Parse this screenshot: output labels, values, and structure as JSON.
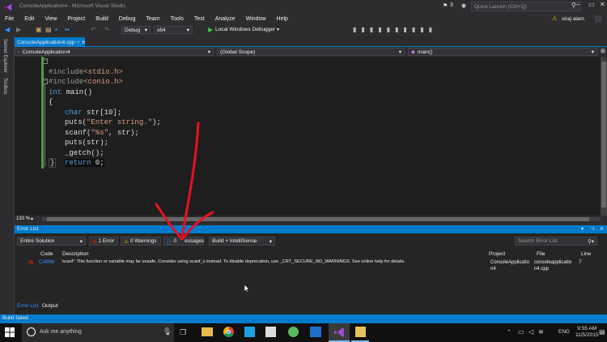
{
  "window": {
    "title": "ConsoleApplication4 - Microsoft Visual Studio",
    "notifications": "3",
    "quick_launch_placeholder": "Quick Launch (Ctrl+Q)",
    "user": "siraj alam"
  },
  "menu": [
    "File",
    "Edit",
    "View",
    "Project",
    "Build",
    "Debug",
    "Team",
    "Tools",
    "Test",
    "Analyze",
    "Window",
    "Help"
  ],
  "toolbar": {
    "config": "Debug",
    "platform": "x64",
    "run_label": "Local Windows Debugger"
  },
  "tab": {
    "label": "ConsoleApplication4.cpp"
  },
  "sidebar": {
    "server_explorer": "Server Explorer",
    "toolbox": "Toolbox"
  },
  "nav": {
    "project": "ConsoleApplication4",
    "scope": "(Global Scope)",
    "member": "main()"
  },
  "code": {
    "line1a": "#include",
    "line1b": "<stdio.h>",
    "line2a": "#include",
    "line2b": "<conio.h>",
    "line3a": "int",
    "line3b": " main()",
    "line4": "{",
    "line5a": "char",
    "line5b": " str[10];",
    "line6a": "puts(",
    "line6b": "\"Enter string.\"",
    "line6c": ");",
    "line7a": "scanf(",
    "line7b": "\"%s\"",
    "line7c": ", str);",
    "line8": "puts(str);",
    "line9": "_getch();",
    "line10a": "return",
    "line10b": " 0;",
    "line11": "}"
  },
  "zoom": "133 %",
  "error_list": {
    "title": "Error List",
    "scope": "Entire Solution",
    "errors": "1 Error",
    "warnings": "0 Warnings",
    "messages_prefix": "0",
    "messages_suffix": "essages",
    "build_filter": "Build + IntelliSense",
    "search_placeholder": "Search Error List",
    "columns": {
      "code": "Code",
      "description": "Description",
      "project": "Project",
      "file": "File",
      "line": "Line"
    },
    "rows": [
      {
        "code": "C4996",
        "description": "'scanf': This function or variable may be unsafe. Consider using scanf_s instead. To disable deprecation, use _CRT_SECURE_NO_WARNINGS. See online help for details.",
        "project_1": "ConsoleApplicatio",
        "project_2": "n4",
        "file_1": "consoleapplicatio",
        "file_2": "n4.cpp",
        "line": "7"
      }
    ],
    "bottom_tabs": [
      "Error List",
      "Output"
    ]
  },
  "status": {
    "text": "Build failed"
  },
  "taskbar": {
    "search_placeholder": "Ask me anything",
    "lang": "ENG",
    "time": "9:55 AM",
    "date": "11/5/2015"
  },
  "colors": {
    "accent": "#007acc",
    "error": "#e51400",
    "annotation": "#e81123"
  }
}
